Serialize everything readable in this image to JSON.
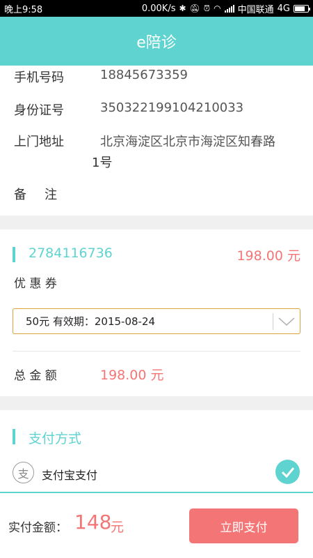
{
  "status_bar": {
    "time": "晚上9:58",
    "net_speed": "0.00K/s",
    "carrier": "中国联通",
    "network": "4G"
  },
  "header": {
    "title": "e陪诊"
  },
  "info": {
    "phone_label": "手机号码",
    "phone_value": "18845673359",
    "id_label": "身份证号",
    "id_value": "350322199104210033",
    "address_label": "上门地址",
    "address_line1": "北京海淀区北京市海淀区知春路",
    "address_line2": "1号",
    "note_label": "备　注"
  },
  "order": {
    "order_no": "2784116736",
    "price": "198.00 元",
    "coupon_label": "优 惠 券",
    "coupon_selected": "50元 有效期：2015-08-24",
    "total_label": "总 金 额",
    "total_value": "198.00 元"
  },
  "payment": {
    "section_title": "支付方式",
    "method_label": "支付宝支付",
    "method_icon": "alipay-icon",
    "selected_icon": "checkmark-circle-icon"
  },
  "footer": {
    "pay_label": "实付金额：",
    "pay_amount": "148",
    "pay_unit": "元",
    "pay_button": "立即支付"
  },
  "colors": {
    "accent": "#5fd3cf",
    "price": "#f47575",
    "select_border": "#d9a33c"
  }
}
